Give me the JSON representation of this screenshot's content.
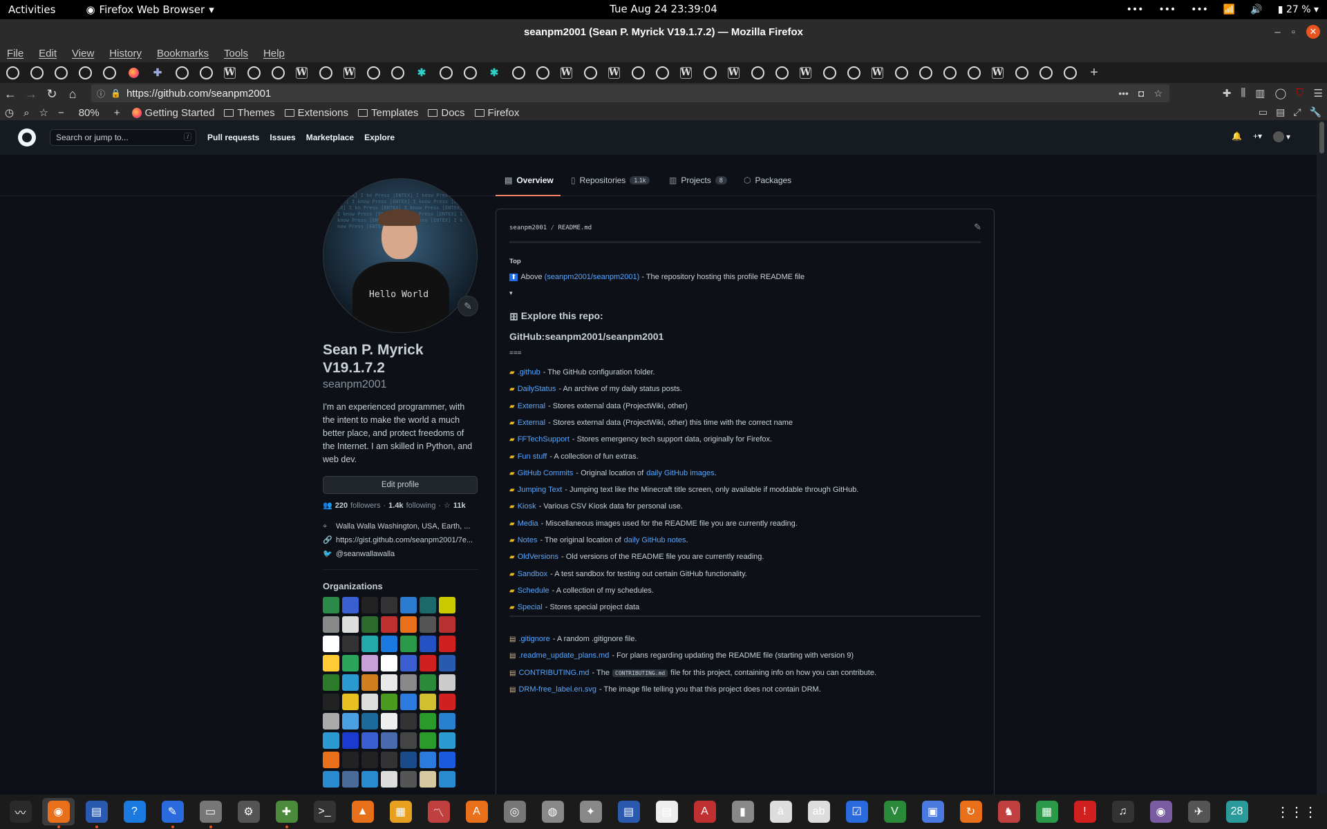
{
  "system": {
    "activities": "Activities",
    "app_name": "Firefox Web Browser",
    "clock": "Tue Aug 24  23:39:04",
    "battery": "27 %"
  },
  "window": {
    "title": "seanpm2001 (Sean P. Myrick V19.1.7.2) — Mozilla Firefox"
  },
  "menubar": [
    "File",
    "Edit",
    "View",
    "History",
    "Bookmarks",
    "Tools",
    "Help"
  ],
  "tabs": [
    "gh",
    "gh",
    "gh",
    "gh",
    "gh",
    "fx",
    "pz",
    "gh",
    "gh",
    "w",
    "gh",
    "gh",
    "w",
    "gh",
    "w",
    "gh",
    "gh",
    "bf",
    "gh",
    "gh",
    "bf",
    "gh",
    "gh",
    "w",
    "gh",
    "w",
    "gh",
    "gh",
    "w",
    "gh",
    "w",
    "gh",
    "gh",
    "w",
    "gh",
    "gh",
    "w",
    "gh",
    "gh",
    "gh",
    "gh",
    "w",
    "gh",
    "gh",
    "gh"
  ],
  "url": "https://github.com/seanpm2001",
  "zoom": "80%",
  "bookmarks": [
    "Getting Started",
    "Themes",
    "Extensions",
    "Templates",
    "Docs",
    "Firefox"
  ],
  "github": {
    "search_placeholder": "Search or jump to...",
    "slash": "/",
    "nav": [
      "Pull requests",
      "Issues",
      "Marketplace",
      "Explore"
    ]
  },
  "profile_tabs": [
    {
      "label": "Overview",
      "count": ""
    },
    {
      "label": "Repositories",
      "count": "1.1k"
    },
    {
      "label": "Projects",
      "count": "8"
    },
    {
      "label": "Packages",
      "count": ""
    }
  ],
  "profile": {
    "avatar_text": "Hello World",
    "name": "Sean P. Myrick V19.1.7.2",
    "login": "seanpm2001",
    "bio": "I'm an experienced programmer, with the intent to make the world a much better place, and protect freedoms of the Internet. I am skilled in Python, and web dev.",
    "edit_profile": "Edit profile",
    "followers": "220",
    "followers_label": "followers",
    "following": "1.4k",
    "following_label": "following",
    "stars": "11k",
    "location": "Walla Walla Washington, USA, Earth, ...",
    "website": "https://gist.github.com/seanpm2001/7e...",
    "twitter": "@seanwallawalla",
    "orgs_title": "Organizations"
  },
  "readme": {
    "path_user": "seanpm2001",
    "path_file": "README.md",
    "top": "Top",
    "above_prefix": "Above",
    "above_link": "(seanpm2001/seanpm2001)",
    "above_rest": "- The repository hosting this profile README file",
    "triangle": "▾",
    "explore_heading": "Explore this repo:",
    "repo_heading": "GitHub:seanpm2001/seanpm2001",
    "eq": "===",
    "folders": [
      {
        "name": ".github",
        "desc": "- The GitHub configuration folder.",
        "link2": ""
      },
      {
        "name": "DailyStatus",
        "desc": "- An archive of my daily status posts.",
        "link2": ""
      },
      {
        "name": "External",
        "desc": "- Stores external data (ProjectWiki, other)",
        "link2": ""
      },
      {
        "name": "External",
        "desc": "- Stores external data (ProjectWiki, other) this time with the correct name",
        "link2": ""
      },
      {
        "name": "FFTechSupport",
        "desc": "- Stores emergency tech support data, originally for Firefox.",
        "link2": ""
      },
      {
        "name": "Fun stuff",
        "desc": "- A collection of fun extras.",
        "link2": ""
      },
      {
        "name": "GitHub Commits",
        "desc": "- Original location of",
        "link2": "daily GitHub images",
        "tail": "."
      },
      {
        "name": "Jumping Text",
        "desc": "- Jumping text like the Minecraft title screen, only available if moddable through GitHub.",
        "link2": ""
      },
      {
        "name": "Kiosk",
        "desc": "- Various CSV Kiosk data for personal use.",
        "link2": ""
      },
      {
        "name": "Media",
        "desc": "- Miscellaneous images used for the README file you are currently reading.",
        "link2": ""
      },
      {
        "name": "Notes",
        "desc": "- The original location of",
        "link2": "daily GitHub notes",
        "tail": "."
      },
      {
        "name": "OldVersions",
        "desc": "- Old versions of the README file you are currently reading.",
        "link2": ""
      },
      {
        "name": "Sandbox",
        "desc": "- A test sandbox for testing out certain GitHub functionality.",
        "link2": ""
      },
      {
        "name": "Schedule",
        "desc": "- A collection of my schedules.",
        "link2": ""
      },
      {
        "name": "Special",
        "desc": "- Stores special project data",
        "link2": ""
      }
    ],
    "files": [
      {
        "name": ".gitignore",
        "desc": "- A random .gitignore file."
      },
      {
        "name": ".readme_update_plans.md",
        "desc": "- For plans regarding updating the README file (starting with version 9)"
      },
      {
        "name": "CONTRIBUTING.md",
        "desc": "- The",
        "code": "CONTRIBUTING.md",
        "tail": "file for this project, containing info on how you can contribute."
      },
      {
        "name": "DRM-free_label.en.svg",
        "desc": "- The image file telling you that this project does not contain DRM."
      }
    ]
  },
  "dock": [
    "system-monitor",
    "firefox",
    "text-editor",
    "help",
    "notes",
    "files",
    "settings",
    "extension",
    "terminal",
    "vlc",
    "office",
    "chart",
    "store",
    "screenshot",
    "disk",
    "prefs",
    "document",
    "writer",
    "pdf",
    "archiver",
    "text",
    "abc",
    "tasks",
    "vim",
    "window",
    "updates",
    "game",
    "calc",
    "alert",
    "music",
    "camera",
    "drone",
    "calendar"
  ],
  "dock_calendar_day": "28",
  "colors": {
    "accent": "#58a6ff",
    "tab_underline": "#f78166",
    "bg": "#0d1117",
    "ubuntu_orange": "#e95420"
  }
}
